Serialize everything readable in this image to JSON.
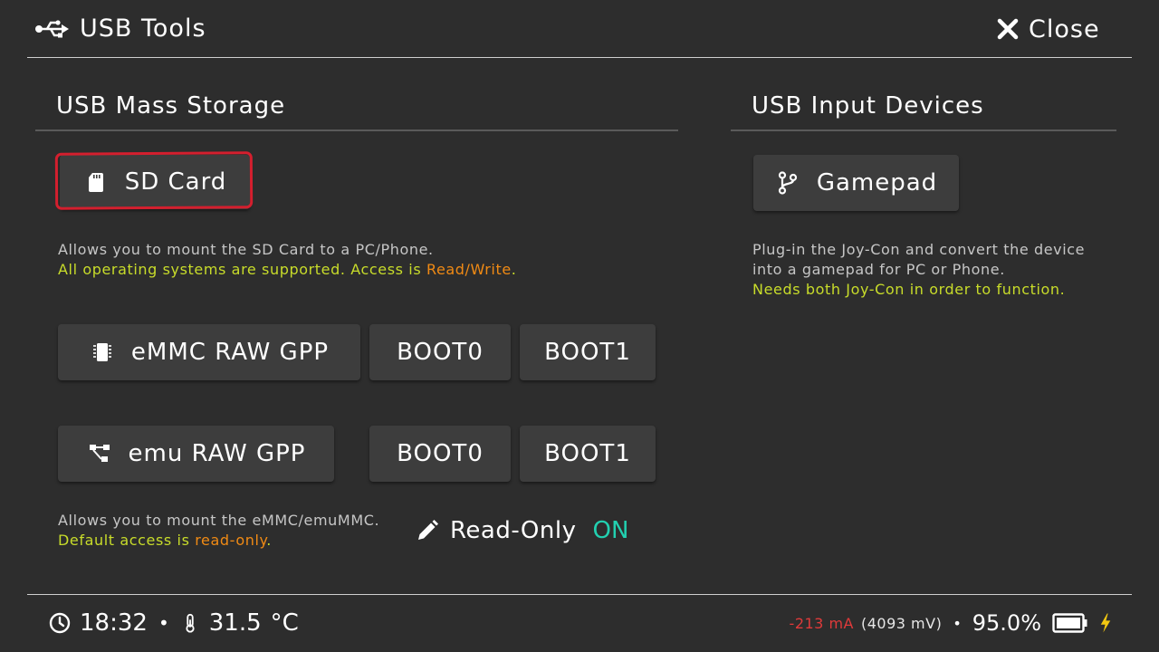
{
  "header": {
    "title": "USB Tools",
    "close_label": "Close"
  },
  "mass_storage": {
    "title": "USB Mass Storage",
    "sd_card": {
      "label": "SD Card",
      "desc_line1": "Allows you to mount the SD Card to a PC/Phone.",
      "desc_line2_prefix": "All operating systems are supported. Access is ",
      "desc_line2_access": "Read/Write",
      "desc_line2_suffix": "."
    },
    "emmc": {
      "label": "eMMC RAW GPP",
      "boot0": "BOOT0",
      "boot1": "BOOT1"
    },
    "emu": {
      "label": "emu RAW GPP",
      "boot0": "BOOT0",
      "boot1": "BOOT1"
    },
    "raw_desc_line1": "Allows you to mount the eMMC/emuMMC.",
    "raw_desc_line2_prefix": "Default access is ",
    "raw_desc_line2_access": "read-only",
    "raw_desc_line2_suffix": ".",
    "read_only": {
      "label": "Read-Only",
      "value": "ON"
    }
  },
  "input_devices": {
    "title": "USB Input Devices",
    "gamepad": {
      "label": "Gamepad",
      "desc_line1": "Plug-in the Joy-Con and convert the device",
      "desc_line2": "into a gamepad for PC or Phone.",
      "desc_line3": "Needs both Joy-Con in order to function."
    }
  },
  "status": {
    "time": "18:32",
    "temp_value": "31.5",
    "temp_unit": "°C",
    "current": "-213 mA",
    "voltage": "(4093 mV)",
    "battery_percent": "95.0%"
  },
  "colors": {
    "background": "#2d2d2d",
    "button": "#3d3d3d",
    "highlight": "#d41f2e",
    "lime_text": "#c8dc2a",
    "orange_text": "#f08a14",
    "on_value": "#22d0b0",
    "current_text": "#e03a3a",
    "charging_bolt": "#f2c811"
  },
  "icons": {
    "header": "usb-icon",
    "close": "close-icon",
    "sd_card": "sd-card-icon",
    "emmc": "chip-icon",
    "emu": "partition-tree-icon",
    "gamepad": "usb-branch-icon",
    "read_only": "pencil-icon",
    "clock": "clock-icon",
    "thermometer": "thermometer-icon",
    "battery": "battery-icon",
    "charging": "lightning-icon"
  }
}
